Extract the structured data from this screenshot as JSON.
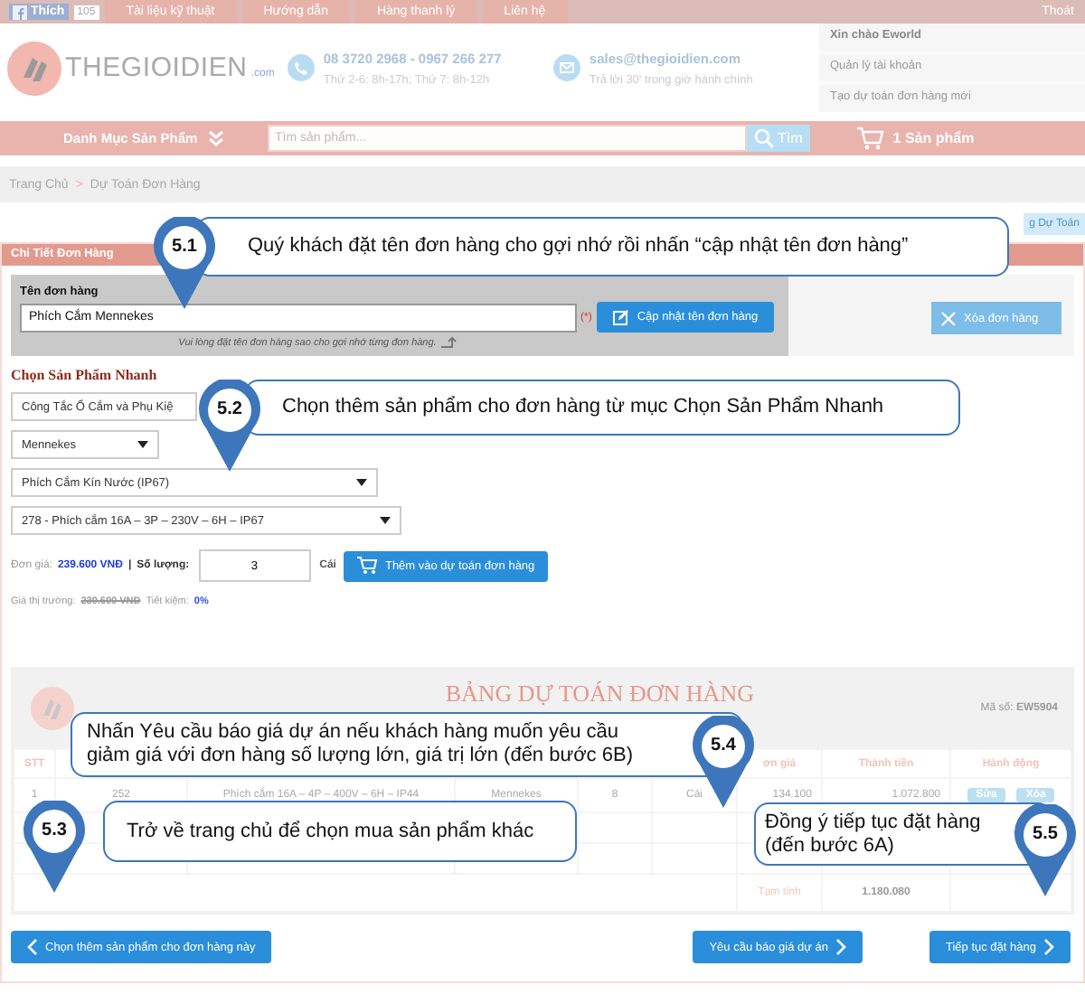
{
  "top_bar": {
    "like_button": "Thích",
    "like_count": "105",
    "links": [
      "Tài liệu kỹ thuật",
      "Hướng dẫn",
      "Hàng thanh lý",
      "Liên hệ"
    ],
    "logout": "Thoát"
  },
  "header": {
    "logo_text": "THEGIOIDIEN",
    "logo_suffix": ".com",
    "phone": "08 3720 2968 - 0967 266 277",
    "hours": "Thứ 2-6: 8h-17h; Thứ 7: 8h-12h",
    "email": "sales@thegioidien.com",
    "email_note": "Trả lời 30' trong giờ hành chính",
    "account_links": [
      "Xin chào Eworld",
      "Quản lý tài khoản",
      "Tạo dự toán đơn hàng mới"
    ]
  },
  "nav": {
    "category": "Danh Mục Sản Phẩm",
    "search_placeholder": "Tìm sản phẩm...",
    "search_button": "Tìm",
    "cart": "1 Sản phẩm"
  },
  "breadcrumb": {
    "items": [
      "Trang Chủ",
      "Dự Toán Đơn Hàng"
    ],
    "separator": ">"
  },
  "partial_button": "g Dự Toán",
  "section_title": "Chi Tiết Đơn Hàng",
  "order_name": {
    "label": "Tên đơn hàng",
    "value": "Phích Cắm Mennekes",
    "required": "(*)",
    "update_button": "Cập nhật tên đơn hàng",
    "hint": "Vui lòng đặt tên đơn hàng sao cho gợi nhớ từng đơn hàng.",
    "delete_button": "Xóa đơn hàng"
  },
  "quick_pick": {
    "title": "Chọn Sản Phẩm Nhanh",
    "selects": [
      {
        "value": "Công Tắc Ổ Cắm và Phụ Kiệ",
        "caret": false
      },
      {
        "value": "Mennekes",
        "caret": true
      },
      {
        "value": "Phích Cắm Kín Nước (IP67)",
        "caret": true
      },
      {
        "value": "278 - Phích cắm 16A – 3P – 230V – 6H – IP67",
        "caret": true
      }
    ],
    "price_label": "Đơn giá:",
    "price": "239.600 VNĐ",
    "divider": "|",
    "qty_label": "Số lượng:",
    "qty": "3",
    "unit": "Cái",
    "add_button": "Thêm vào dự toán đơn hàng",
    "market_label": "Giá thị trường:",
    "market_price": "239.600 VNĐ",
    "saving_label": "Tiết kiệm:",
    "saving": "0%"
  },
  "estimate": {
    "title": "BẢNG DỰ TOÁN ĐƠN HÀNG",
    "code_label": "Mã số:",
    "code": "EW5904",
    "columns": [
      {
        "label": "STT"
      },
      {},
      {},
      {},
      {},
      {},
      {
        "label": "ơn giá"
      },
      {
        "label": "Thành tiền"
      },
      {
        "label": "Hành động"
      }
    ],
    "rows": [
      {
        "cells": [
          "1",
          "252",
          "Phích cắm 16A – 4P – 400V – 6H – IP44",
          "Mennekes",
          "8",
          "Cái",
          "134.100",
          "1.072.800"
        ],
        "actions": [
          "Sửa",
          "Xóa"
        ]
      }
    ],
    "subtotal_label": "Tạm tính",
    "subtotal": "1.180.080"
  },
  "buttons": {
    "back": "Chọn thêm sản phẩm cho đơn hàng này",
    "quote": "Yêu cầu báo giá dự án",
    "next": "Tiếp tục đặt hàng"
  },
  "callouts": [
    {
      "number": "5.1",
      "text": "Quý khách đặt tên đơn hàng cho gợi nhớ rồi nhấn “cập nhật tên đơn hàng”"
    },
    {
      "number": "5.2",
      "text": "Chọn thêm sản phẩm cho đơn hàng từ mục Chọn Sản Phẩm Nhanh"
    },
    {
      "number": "5.4",
      "text": "Nhấn Yêu cầu báo giá dự án nếu khách hàng muốn yêu cầu giảm giá với đơn hàng số lượng lớn, giá trị lớn (đến bước 6B)"
    },
    {
      "number": "5.3",
      "text": "Trở về trang chủ để chọn mua sản phẩm khác"
    },
    {
      "number": "5.5",
      "text": "Đồng ý tiếp tục đặt hàng (đến bước 6A)"
    }
  ]
}
